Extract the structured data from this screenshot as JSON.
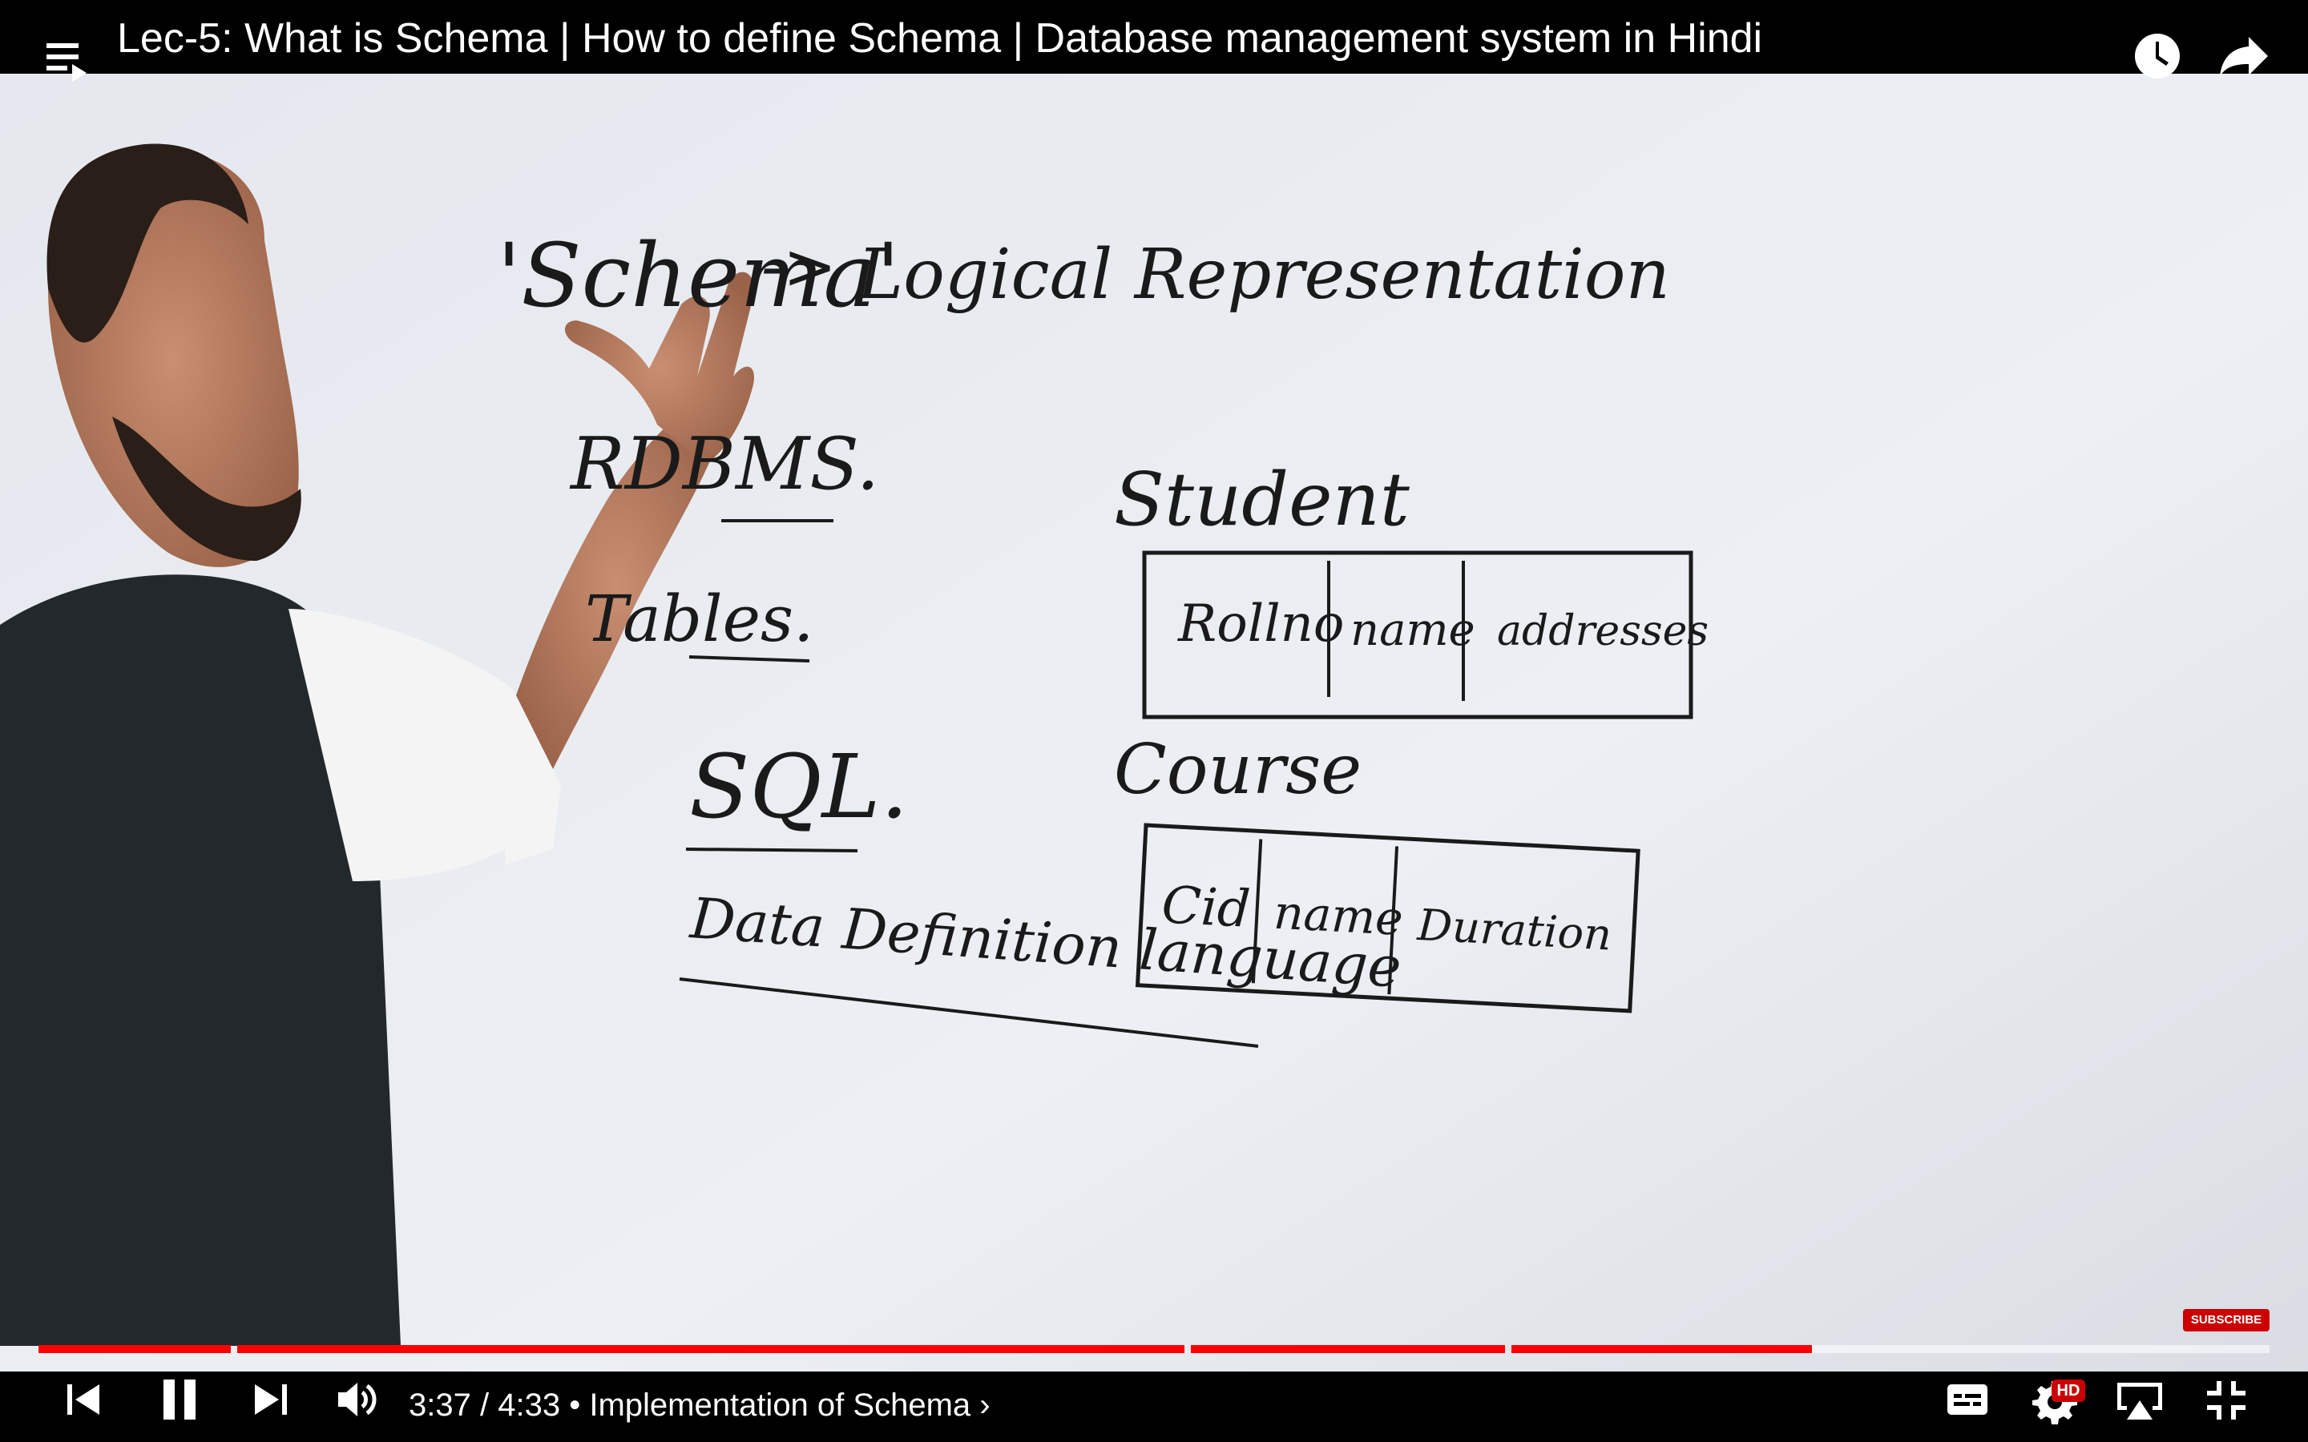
{
  "video": {
    "title": "Lec-5: What is Schema | How to define Schema | Database management system in Hindi",
    "chapter": "Implementation of Schema",
    "current_time": "3:37",
    "duration": "4:33",
    "progress": 0.795
  },
  "board": {
    "heading_schema": "'Schema'",
    "arrow": "->",
    "heading_definition": "Logical Representation",
    "rdbms": "RDBMS.",
    "tables": "Tables.",
    "sql": "SQL.",
    "ddl": "Data Definition language",
    "student_label": "Student",
    "student_columns": [
      "Rollno",
      "name",
      "addresses"
    ],
    "course_label": "Course",
    "course_columns": [
      "Cid",
      "name",
      "Duration"
    ]
  },
  "overlay": {
    "subscribe": "SUBSCRIBE",
    "hd": "HD"
  },
  "icons": {
    "playlist": "playlist-icon",
    "watch_later": "clock-icon",
    "share": "share-arrow-icon",
    "previous": "skip-previous-icon",
    "pause": "pause-icon",
    "next": "skip-next-icon",
    "volume": "volume-icon",
    "captions": "captions-icon",
    "settings": "gear-icon",
    "airplay": "airplay-icon",
    "exit_fullscreen": "exit-fullscreen-icon"
  },
  "colors": {
    "accent": "#ff0000",
    "board": "#e8ecf0",
    "ink": "#1a1a1a"
  }
}
